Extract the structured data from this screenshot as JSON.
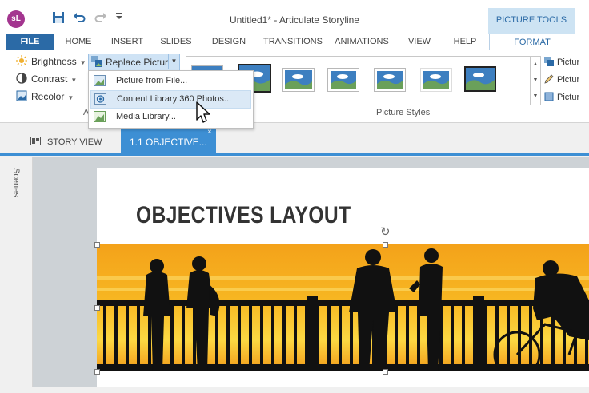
{
  "app": {
    "logo_text": "sL",
    "window_title": "Untitled1* -  Articulate Storyline",
    "contextual_group": "PICTURE TOOLS",
    "accent_color": "#2b6aa6",
    "tab_accent_color": "#3d8fd4"
  },
  "quick_access": {
    "save_icon": "save-icon",
    "undo_icon": "undo-icon",
    "redo_icon": "redo-icon",
    "customize_icon": "customize-caret-icon"
  },
  "ribbon_tabs": [
    {
      "label": "FILE"
    },
    {
      "label": "HOME"
    },
    {
      "label": "INSERT"
    },
    {
      "label": "SLIDES"
    },
    {
      "label": "DESIGN"
    },
    {
      "label": "TRANSITIONS"
    },
    {
      "label": "ANIMATIONS"
    },
    {
      "label": "VIEW"
    },
    {
      "label": "HELP"
    },
    {
      "label": "FORMAT"
    }
  ],
  "adjust_group": {
    "brightness": "Brightness",
    "contrast": "Contrast",
    "recolor": "Recolor",
    "replace_picture": "Replace Picture",
    "label_fragment": "A"
  },
  "picture_styles": {
    "label": "Picture Styles",
    "selected_index": 1
  },
  "right_group": {
    "items": [
      "Pictur",
      "Pictur",
      "Pictur"
    ]
  },
  "dropdown": {
    "items": [
      {
        "label": "Picture from File..."
      },
      {
        "label": "Content Library 360 Photos..."
      },
      {
        "label": "Media Library..."
      }
    ],
    "highlighted_index": 1
  },
  "view_tabs": {
    "story_view": "STORY VIEW",
    "slide_tab": "1.1 OBJECTIVE...",
    "close": "×"
  },
  "scenes_panel": {
    "label": "Scenes"
  },
  "slide": {
    "title": "OBJECTIVES LAYOUT"
  }
}
